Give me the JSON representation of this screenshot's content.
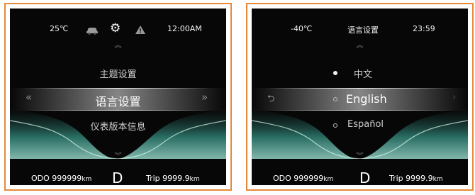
{
  "left_screen": {
    "temperature": "25℃",
    "time": "12:00AM",
    "icons": [
      "car-icon",
      "gear-icon",
      "warning-icon"
    ],
    "menu": {
      "item_above": "主题设置",
      "item_selected": "语言设置",
      "item_below": "仪表版本信息"
    },
    "nav": {
      "left": "«",
      "right": "»"
    },
    "odo_label": "ODO",
    "odo_value": "999999",
    "odo_unit": "km",
    "gear": "D",
    "trip_label": "Trip",
    "trip_value": "9999.9",
    "trip_unit": "km"
  },
  "right_screen": {
    "temperature": "-40℃",
    "title": "语言设置",
    "time": "23:59",
    "options": [
      {
        "label": "中文",
        "checked": true
      },
      {
        "label": "English",
        "checked": false
      },
      {
        "label": "Español",
        "checked": false
      }
    ],
    "back": "⮌",
    "odo_label": "ODO",
    "odo_value": "999999",
    "odo_unit": "km",
    "gear": "D",
    "trip_label": "Trip",
    "trip_value": "9999.9",
    "trip_unit": "km"
  },
  "colors": {
    "panel_border": "#e58a3a",
    "accent_glow": "#3cc6a7"
  }
}
